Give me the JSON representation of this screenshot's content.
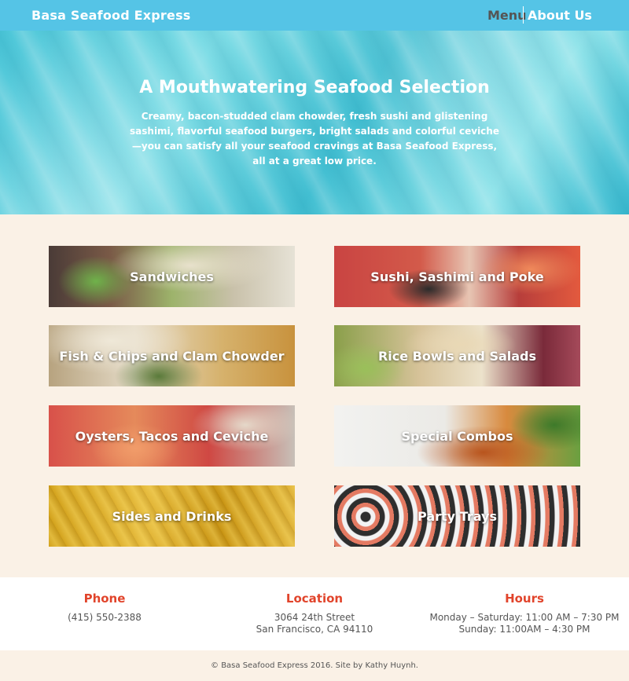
{
  "navbar": {
    "brand": "Basa Seafood Express",
    "links": [
      {
        "label": "Menu"
      },
      {
        "label": "About Us"
      }
    ]
  },
  "hero": {
    "title": "A Mouthwatering Seafood Selection",
    "text": "Creamy, bacon-studded clam chowder, fresh sushi and glistening sashimi, flavorful seafood burgers, bright salads and colorful ceviche—you can satisfy all your seafood cravings at Basa Seafood Express, all at a great low price."
  },
  "menu_categories": [
    {
      "label": "Sandwiches"
    },
    {
      "label": "Sushi, Sashimi and Poke"
    },
    {
      "label": "Fish & Chips and Clam Chowder"
    },
    {
      "label": "Rice Bowls and Salads"
    },
    {
      "label": "Oysters, Tacos and Ceviche"
    },
    {
      "label": "Special Combos"
    },
    {
      "label": "Sides and Drinks"
    },
    {
      "label": "Party Trays"
    }
  ],
  "info": {
    "phone": {
      "heading": "Phone",
      "value": "(415) 550-2388"
    },
    "location": {
      "heading": "Location",
      "line1": "3064 24th Street",
      "line2": "San Francisco, CA 94110"
    },
    "hours": {
      "heading": "Hours",
      "line1": "Monday – Saturday: 11:00 AM – 7:30 PM",
      "line2": "Sunday: 11:00AM – 4:30 PM"
    }
  },
  "footer": {
    "text": "© Basa Seafood Express 2016. Site by Kathy Huynh."
  },
  "colors": {
    "navbar": "#55c4e6",
    "accent": "#e1442b",
    "page_background": "#faf1e6"
  }
}
